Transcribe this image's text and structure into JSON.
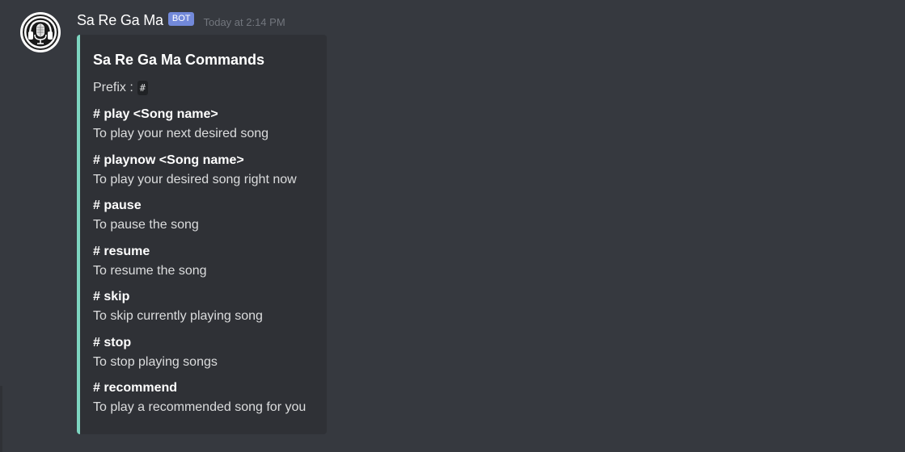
{
  "message": {
    "username": "Sa Re Ga Ma",
    "bot_tag": "BOT",
    "timestamp": "Today at 2:14 PM",
    "avatar_icon": "headphones-microphone-icon"
  },
  "embed": {
    "accent_color": "#7ed6c1",
    "title": "Sa Re Ga Ma Commands",
    "prefix_label": "Prefix :",
    "prefix_value": "#",
    "fields": [
      {
        "name": "# play <Song name>",
        "value": "To play your next desired song"
      },
      {
        "name": "# playnow <Song name>",
        "value": "To play your desired song right now"
      },
      {
        "name": "# pause",
        "value": "To pause the song"
      },
      {
        "name": "# resume",
        "value": "To resume the song"
      },
      {
        "name": "# skip",
        "value": "To skip currently playing song"
      },
      {
        "name": "# stop",
        "value": "To stop playing songs"
      },
      {
        "name": "# recommend",
        "value": "To play a recommended song for you"
      }
    ]
  },
  "colors": {
    "background": "#36393f",
    "embed_background": "#2f3136",
    "bot_tag": "#7289da"
  }
}
